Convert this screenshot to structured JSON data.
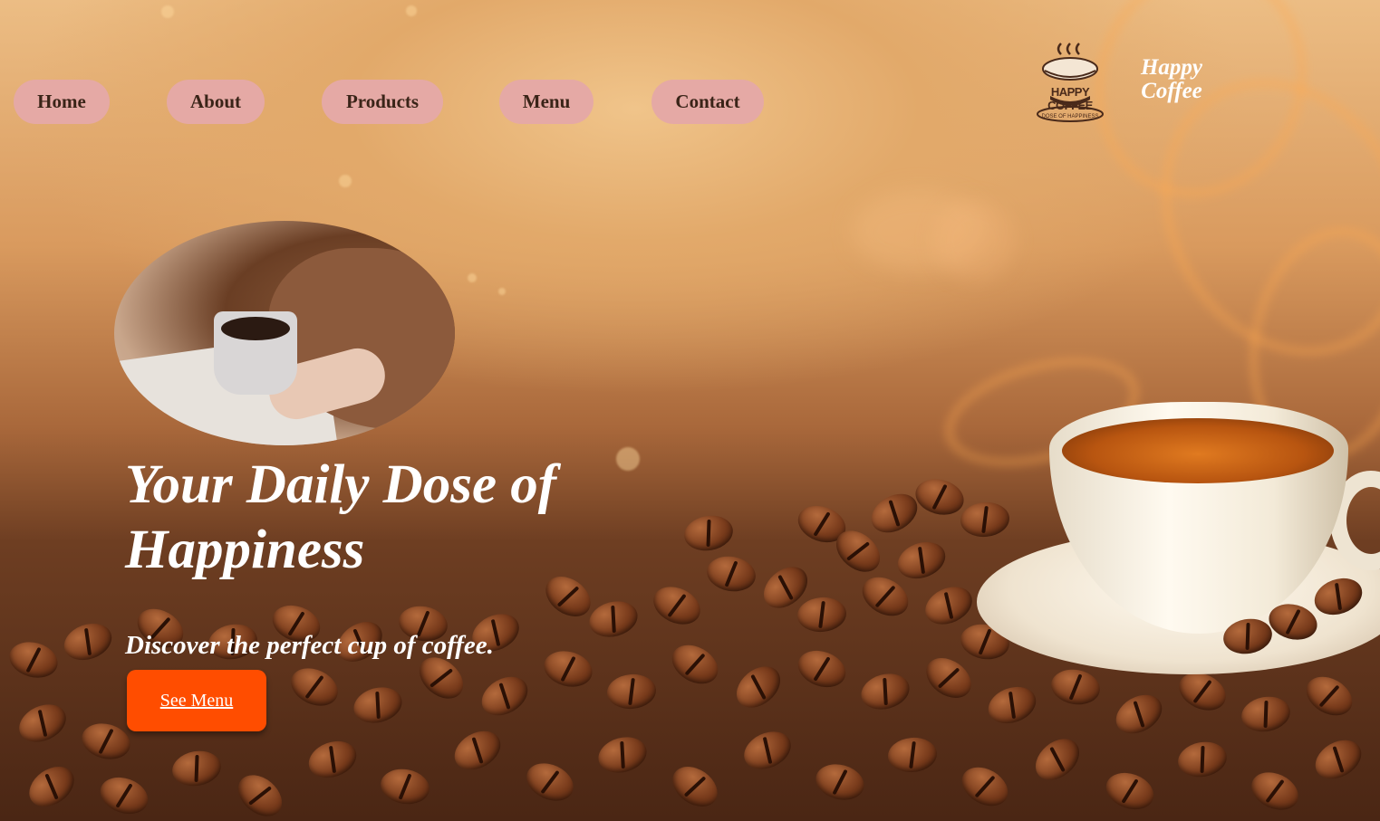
{
  "nav": {
    "items": [
      {
        "label": "Home"
      },
      {
        "label": "About"
      },
      {
        "label": "Products"
      },
      {
        "label": "Menu"
      },
      {
        "label": "Contact"
      }
    ]
  },
  "brand": {
    "name_line1": "Happy",
    "name_line2": "Coffee",
    "logo_wordmark": "HAPPY COFFEE",
    "logo_slogan": "DOSE OF HAPPINESS"
  },
  "hero": {
    "headline": "Your Daily Dose of Happiness",
    "tagline": "Discover the perfect cup of coffee.",
    "cta_label": "See Menu"
  },
  "colors": {
    "nav_pill": "#e5a9a5",
    "cta": "#ff4d00",
    "text_on_hero": "#ffffff"
  }
}
